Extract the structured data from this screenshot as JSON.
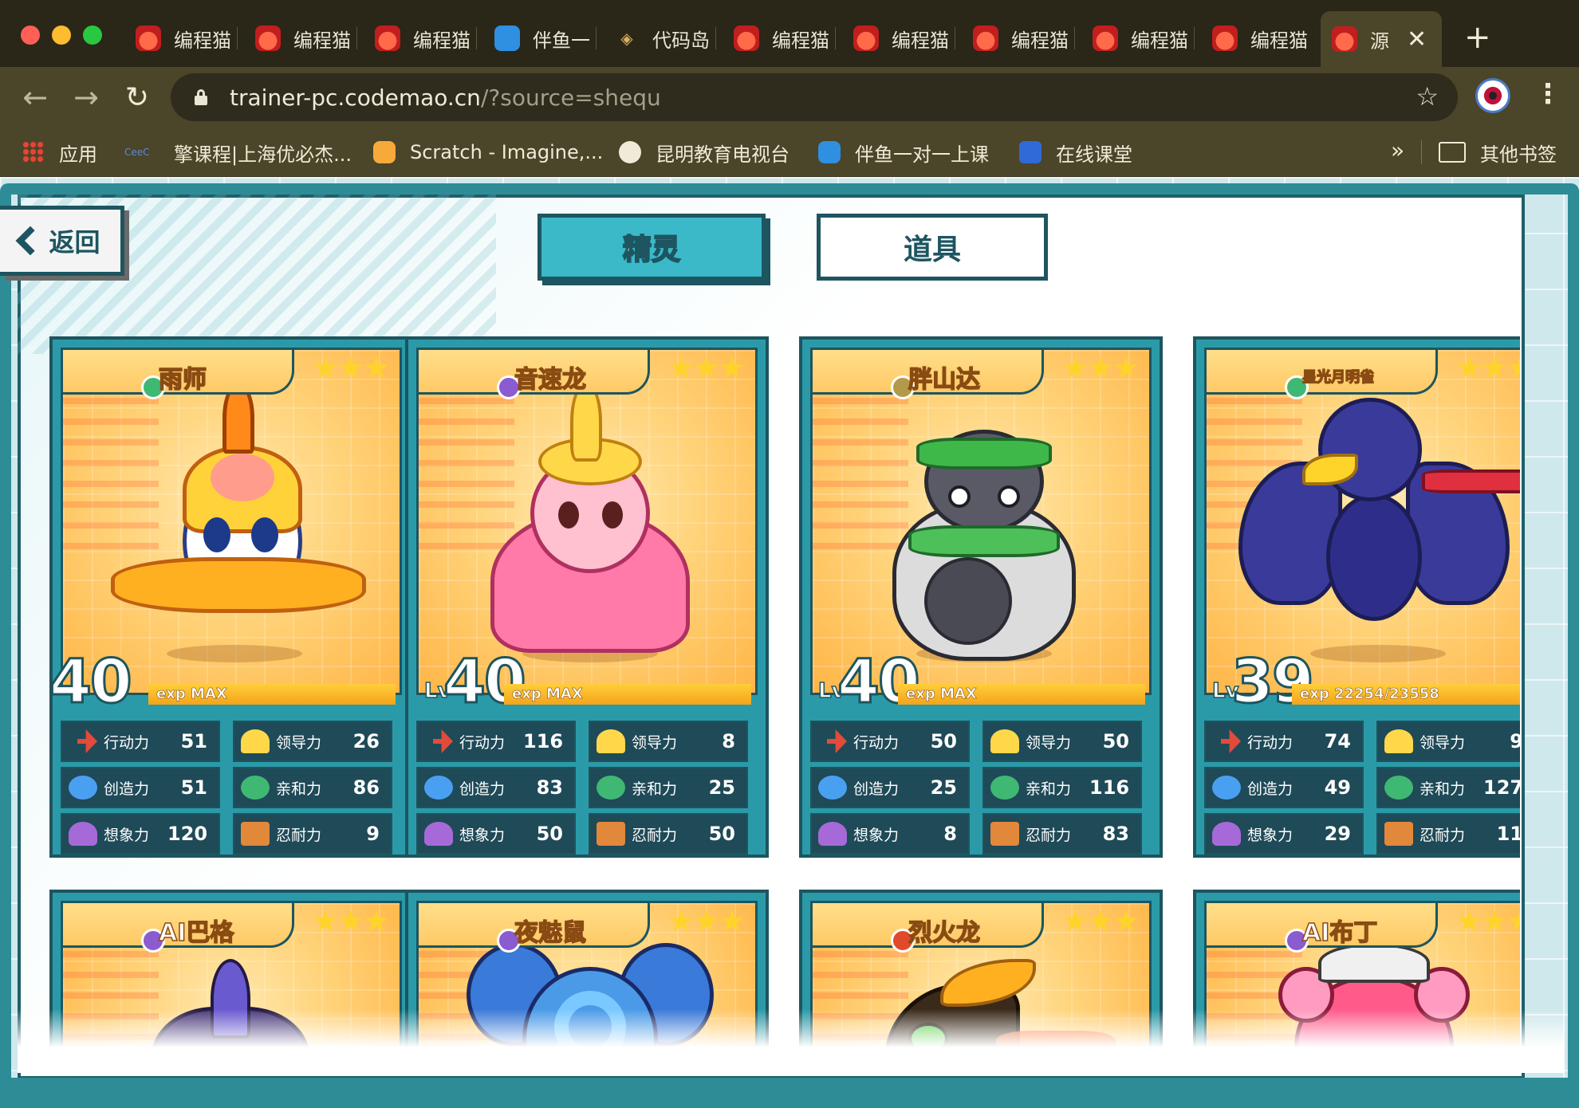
{
  "browser": {
    "tabs": [
      {
        "title": "编程猫",
        "icon": "codemao-cat-icon"
      },
      {
        "title": "编程猫",
        "icon": "codemao-cat-icon"
      },
      {
        "title": "编程猫",
        "icon": "codemao-cat-icon"
      },
      {
        "title": "伴鱼一",
        "icon": "banyu-fish-icon"
      },
      {
        "title": "代码岛",
        "icon": "code-island-icon"
      },
      {
        "title": "编程猫",
        "icon": "codemao-cat-icon"
      },
      {
        "title": "编程猫",
        "icon": "codemao-cat-icon"
      },
      {
        "title": "编程猫",
        "icon": "codemao-cat-icon"
      },
      {
        "title": "编程猫",
        "icon": "codemao-cat-icon"
      },
      {
        "title": "编程猫",
        "icon": "codemao-cat-icon"
      },
      {
        "title": "源",
        "icon": "codemao-cat-icon",
        "active": true
      }
    ],
    "url_host": "trainer-pc.codemao.cn",
    "url_path": "/?source=shequ",
    "bookmarks": [
      {
        "label": "应用",
        "icon": "apps-grid-icon"
      },
      {
        "label": "擎课程|上海优必杰...",
        "icon": "site-icon"
      },
      {
        "label": "Scratch - Imagine,...",
        "icon": "scratch-icon"
      },
      {
        "label": "昆明教育电视台",
        "icon": "globe-icon"
      },
      {
        "label": "伴鱼一对一上课",
        "icon": "banyu-fish-icon"
      },
      {
        "label": "在线课堂",
        "icon": "classroom-icon"
      }
    ],
    "bookmarks_more": "»",
    "other_bookmarks": "其他书签"
  },
  "page": {
    "back_label": "返回",
    "tabs": {
      "active": "精灵",
      "inactive": "道具"
    },
    "stat_labels": {
      "action": "行动力",
      "lead": "领导力",
      "create": "创造力",
      "affinity": "亲和力",
      "imagination": "想象力",
      "endurance": "忍耐力"
    },
    "lv_prefix": "Lv",
    "cards": [
      {
        "name": "雨师",
        "element": "green",
        "stars": 3,
        "level": "40",
        "exp": "exp MAX",
        "exp_fill": 1.0,
        "stats": {
          "action": "51",
          "lead": "26",
          "create": "51",
          "affinity": "86",
          "imagination": "120",
          "endurance": "9"
        }
      },
      {
        "name": "音速龙",
        "element": "purple",
        "stars": 3,
        "level": "40",
        "exp": "exp MAX",
        "exp_fill": 1.0,
        "stats": {
          "action": "116",
          "lead": "8",
          "create": "83",
          "affinity": "25",
          "imagination": "50",
          "endurance": "50"
        }
      },
      {
        "name": "胖山达",
        "element": "olive",
        "stars": 3,
        "level": "40",
        "exp": "exp MAX",
        "exp_fill": 1.0,
        "stats": {
          "action": "50",
          "lead": "50",
          "create": "25",
          "affinity": "116",
          "imagination": "8",
          "endurance": "83"
        }
      },
      {
        "name": "星光月明雀",
        "element": "green",
        "stars": 3,
        "level": "39",
        "exp": "exp 22254/23558",
        "exp_fill": 0.945,
        "stats": {
          "action": "74",
          "lead": "9",
          "create": "49",
          "affinity": "127",
          "imagination": "29",
          "endurance": "11"
        }
      }
    ],
    "cards_row2": [
      {
        "name": "AI巴格",
        "element": "purple",
        "stars": 3
      },
      {
        "name": "夜魅鼠",
        "element": "purple",
        "stars": 3
      },
      {
        "name": "烈火龙",
        "element": "red",
        "stars": 3
      },
      {
        "name": "AI布丁",
        "element": "purple",
        "stars": 3
      }
    ]
  }
}
